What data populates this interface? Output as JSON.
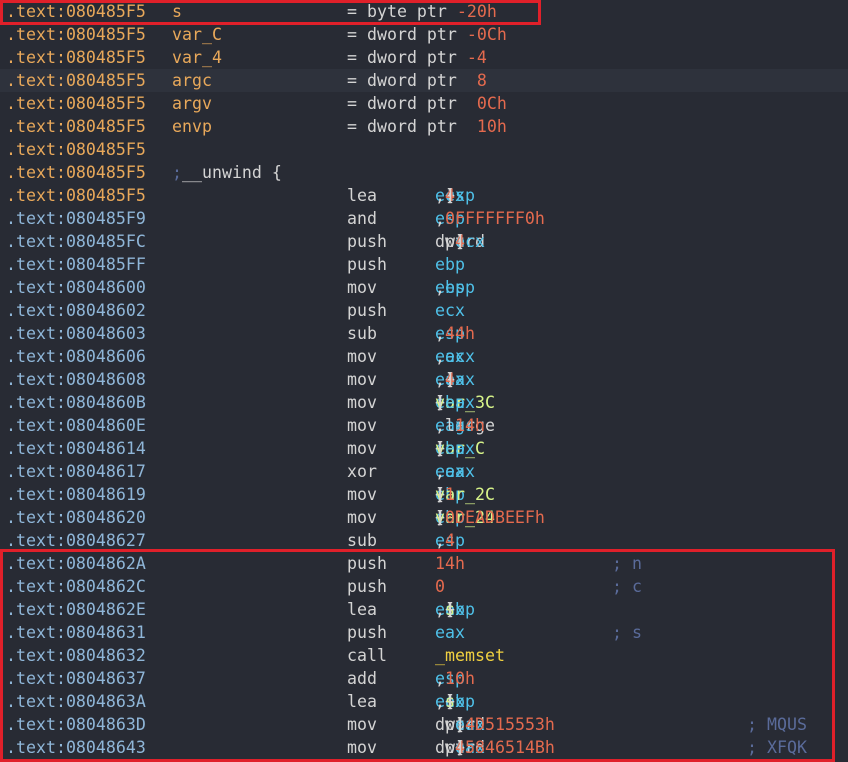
{
  "lines": [
    {
      "addr": ".text:080485F5",
      "label": "s",
      "eq": "= byte ptr -20h"
    },
    {
      "addr": ".text:080485F5",
      "label": "var_C",
      "eq": "= dword ptr -0Ch"
    },
    {
      "addr": ".text:080485F5",
      "label": "var_4",
      "eq": "= dword ptr -4"
    },
    {
      "addr": ".text:080485F5",
      "label": "argc",
      "eq": "= dword ptr  8"
    },
    {
      "addr": ".text:080485F5",
      "label": "argv",
      "eq": "= dword ptr  0Ch"
    },
    {
      "addr": ".text:080485F5",
      "label": "envp",
      "eq": "= dword ptr  10h"
    },
    {
      "addr": ".text:080485F5"
    },
    {
      "addr": ".text:080485F5",
      "comment": "; __unwind {"
    },
    {
      "addr": ".text:080485F5",
      "mn": "lea",
      "op": "ecx, [esp+4]"
    },
    {
      "addr": ".text:080485F9",
      "mn": "and",
      "op": "esp, 0FFFFFFF0h"
    },
    {
      "addr": ".text:080485FC",
      "mn": "push",
      "op": "dword ptr [ecx-4]"
    },
    {
      "addr": ".text:080485FF",
      "mn": "push",
      "op": "ebp"
    },
    {
      "addr": ".text:08048600",
      "mn": "mov",
      "op": "ebp, esp"
    },
    {
      "addr": ".text:08048602",
      "mn": "push",
      "op": "ecx"
    },
    {
      "addr": ".text:08048603",
      "mn": "sub",
      "op": "esp, 44h"
    },
    {
      "addr": ".text:08048606",
      "mn": "mov",
      "op": "eax, ecx"
    },
    {
      "addr": ".text:08048608",
      "mn": "mov",
      "op": "eax, [eax+4]"
    },
    {
      "addr": ".text:0804860B",
      "mn": "mov",
      "op": "[ebp+var_3C], eax"
    },
    {
      "addr": ".text:0804860E",
      "mn": "mov",
      "op": "eax, large gs:14h"
    },
    {
      "addr": ".text:08048614",
      "mn": "mov",
      "op": "[ebp+var_C], eax"
    },
    {
      "addr": ".text:08048617",
      "mn": "xor",
      "op": "eax, eax"
    },
    {
      "addr": ".text:08048619",
      "mn": "mov",
      "op": "[ebp+var_2C], 1"
    },
    {
      "addr": ".text:08048620",
      "mn": "mov",
      "op": "[ebp+var_24], 0DEADBEEFh"
    },
    {
      "addr": ".text:08048627",
      "mn": "sub",
      "op": "esp, 4"
    },
    {
      "addr": ".text:0804862A",
      "mn": "push",
      "op": "14h",
      "comment": "; n"
    },
    {
      "addr": ".text:0804862C",
      "mn": "push",
      "op": "0",
      "comment": "; c"
    },
    {
      "addr": ".text:0804862E",
      "mn": "lea",
      "op": "eax, [ebp+s]"
    },
    {
      "addr": ".text:08048631",
      "mn": "push",
      "op": "eax",
      "comment": "; s"
    },
    {
      "addr": ".text:08048632",
      "mn": "call",
      "op": "_memset"
    },
    {
      "addr": ".text:08048637",
      "mn": "add",
      "op": "esp, 10h"
    },
    {
      "addr": ".text:0804863A",
      "mn": "lea",
      "op": "eax, [ebp+s]"
    },
    {
      "addr": ".text:0804863D",
      "mn": "mov",
      "op": "dword ptr [eax], 4D515553h",
      "comment": "; MQUS"
    },
    {
      "addr": ".text:08048643",
      "mn": "mov",
      "op": "dword ptr [eax+4], 5846514Bh",
      "comment": "; XFQK"
    }
  ],
  "colors": {
    "background": "#282b34",
    "address": "#8fb6d8",
    "label": "#e8a85a",
    "register": "#4fc1e9",
    "number": "#e46a4e",
    "variable": "#d8f58a",
    "function": "#f0d040",
    "comment": "#5a6b9a",
    "highlight": "#e0202a"
  }
}
